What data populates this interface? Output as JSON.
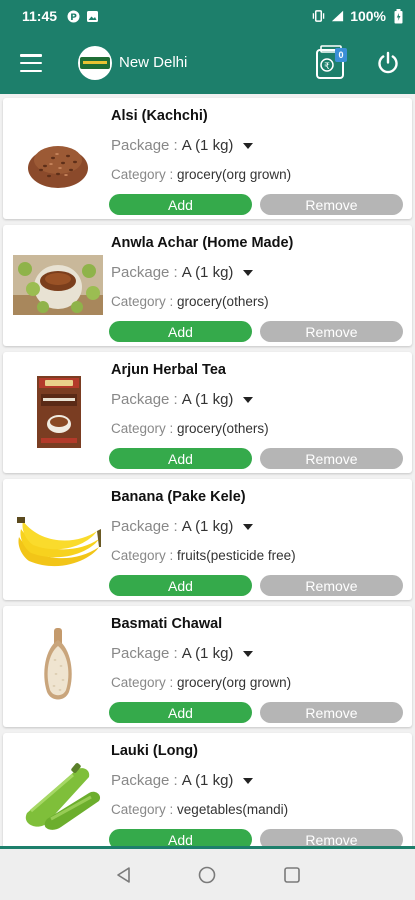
{
  "status_bar": {
    "time": "11:45",
    "battery": "100%",
    "icons": [
      "p-icon",
      "image-icon",
      "vibrate-icon",
      "signal-icon",
      "battery-icon"
    ]
  },
  "header": {
    "city": "New Delhi",
    "cart_count": "0",
    "brand_color": "#1d7f6b",
    "icons": [
      "menu-icon",
      "logo",
      "wallet-icon",
      "power-icon"
    ]
  },
  "products": [
    {
      "name": "Alsi (Kachchi)",
      "package_label": "Package :",
      "package_value": "A (1 kg)",
      "category_label": "Category :",
      "category_value": "grocery(org grown)",
      "add_label": "Add",
      "remove_label": "Remove"
    },
    {
      "name": "Anwla Achar (Home Made)",
      "package_label": "Package :",
      "package_value": "A (1 kg)",
      "category_label": "Category :",
      "category_value": "grocery(others)",
      "add_label": "Add",
      "remove_label": "Remove"
    },
    {
      "name": "Arjun Herbal Tea",
      "package_label": "Package :",
      "package_value": "A (1 kg)",
      "category_label": "Category :",
      "category_value": "grocery(others)",
      "add_label": "Add",
      "remove_label": "Remove"
    },
    {
      "name": "Banana (Pake Kele)",
      "package_label": "Package :",
      "package_value": "A (1 kg)",
      "category_label": "Category :",
      "category_value": "fruits(pesticide free)",
      "add_label": "Add",
      "remove_label": "Remove"
    },
    {
      "name": "Basmati Chawal",
      "package_label": "Package :",
      "package_value": "A (1 kg)",
      "category_label": "Category :",
      "category_value": "grocery(org grown)",
      "add_label": "Add",
      "remove_label": "Remove"
    },
    {
      "name": "Lauki (Long)",
      "package_label": "Package :",
      "package_value": "A (1 kg)",
      "category_label": "Category :",
      "category_value": "vegetables(mandi)",
      "add_label": "Add",
      "remove_label": "Remove"
    }
  ],
  "colors": {
    "add": "#35aa4b",
    "remove": "#b5b5b5"
  },
  "nav_bar": {
    "icons": [
      "back-icon",
      "home-icon",
      "recents-icon"
    ]
  }
}
